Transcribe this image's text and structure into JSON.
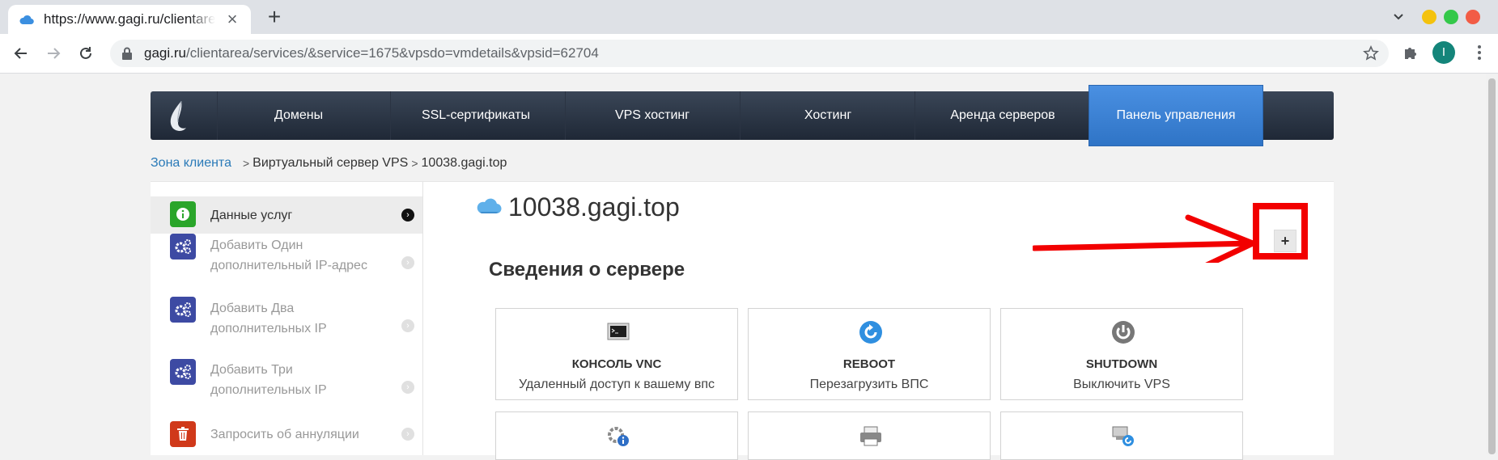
{
  "browser": {
    "tab_title": "https://www.gagi.ru/clientarea",
    "close_glyph": "×",
    "new_tab_glyph": "+",
    "url_host": "gagi.ru",
    "url_path": "/clientarea/services/&service=1675&vpsdo=vmdetails&vpsid=62704",
    "profile_initial": "I"
  },
  "nav": {
    "items": [
      "Домены",
      "SSL-сертификаты",
      "VPS хостинг",
      "Хостинг",
      "Аренда серверов",
      "Панель управления"
    ],
    "active_index": 5
  },
  "breadcrumb": {
    "home": "Зона клиента",
    "sep": ">",
    "items": [
      "Виртуальный сервер VPS",
      "10038.gagi.top"
    ]
  },
  "sidebar": {
    "items": [
      {
        "label": "Данные услуг",
        "icon": "info-icon",
        "color": "#2aa52a"
      },
      {
        "label": "Добавить Один дополнительный IP-адрес",
        "icon": "gears-icon",
        "color": "#3d4aa3"
      },
      {
        "label": "Добавить Два дополнительных IP",
        "icon": "gears-icon",
        "color": "#3d4aa3"
      },
      {
        "label": "Добавить Три дополнительных IP",
        "icon": "gears-icon",
        "color": "#3d4aa3"
      },
      {
        "label": "Запросить об аннуляции",
        "icon": "trash-icon",
        "color": "#d0391a"
      }
    ]
  },
  "server": {
    "name": "10038.gagi.top",
    "section_title": "Сведения о сервере",
    "plus_label": "+"
  },
  "tiles": [
    {
      "name": "КОНСОЛЬ VNC",
      "desc": "Удаленный доступ к вашему впс",
      "icon": "terminal-icon"
    },
    {
      "name": "REBOOT",
      "desc": "Перезагрузить ВПС",
      "icon": "reboot-icon"
    },
    {
      "name": "SHUTDOWN",
      "desc": "Выключить VPS",
      "icon": "power-icon"
    },
    {
      "name": "",
      "desc": "",
      "icon": "settings-info-icon"
    },
    {
      "name": "",
      "desc": "",
      "icon": "printer-icon"
    },
    {
      "name": "",
      "desc": "",
      "icon": "network-refresh-icon"
    }
  ],
  "colors": {
    "accent_blue": "#2f74c6",
    "annotation_red": "#f20000",
    "nav_dark": "#1f2836"
  }
}
